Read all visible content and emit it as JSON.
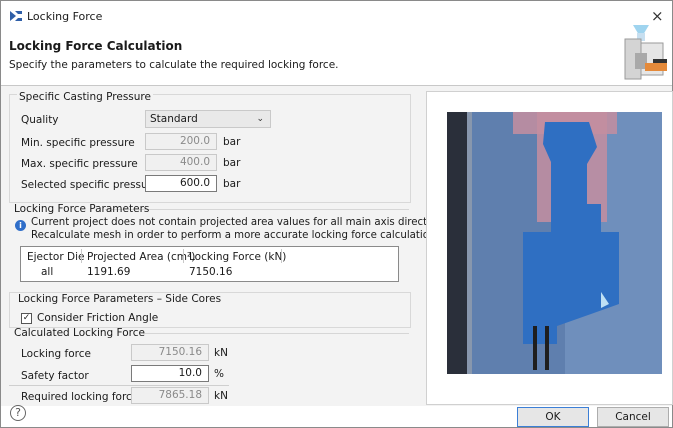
{
  "window": {
    "title": "Locking Force",
    "close_symbol": "×"
  },
  "header": {
    "title": "Locking Force Calculation",
    "subtitle": "Specify the parameters to calculate the required locking force."
  },
  "casting_pressure": {
    "group_title": "Specific Casting Pressure",
    "quality_label": "Quality",
    "quality_value": "Standard",
    "min_label": "Min. specific pressure",
    "min_value": "200.0",
    "max_label": "Max. specific pressure",
    "max_value": "400.0",
    "selected_label": "Selected specific pressure",
    "selected_value": "600.0",
    "unit": "bar"
  },
  "locking_params": {
    "group_title": "Locking Force Parameters",
    "info_line1": "Current project does not contain projected area values for all main axis directions.",
    "info_line2": "Recalculate mesh in order to perform a more accurate locking force calculation.",
    "table": {
      "headers": [
        "Ejector Die",
        "Projected Area (cm²)",
        "Locking Force (kN)"
      ],
      "rows": [
        [
          "all",
          "1191.69",
          "7150.16"
        ]
      ]
    }
  },
  "side_cores": {
    "group_title": "Locking Force Parameters  –  Side Cores",
    "friction_label": "Consider Friction Angle",
    "friction_checked": true
  },
  "calculated": {
    "group_title": "Calculated Locking Force",
    "locking_label": "Locking force",
    "locking_value": "7150.16",
    "locking_unit": "kN",
    "safety_label": "Safety factor",
    "safety_value": "10.0",
    "safety_unit": "%",
    "required_label": "Required locking force",
    "required_value": "7865.18",
    "required_unit": "kN"
  },
  "buttons": {
    "ok": "OK",
    "cancel": "Cancel",
    "help_symbol": "?"
  },
  "icons": {
    "app": "locking-force-app-icon",
    "info": "info-icon",
    "help": "help-icon",
    "dropdown": "chevron-down-icon",
    "header": "die-casting-machine-icon",
    "preview": "casting-part-preview"
  },
  "colors": {
    "preview_background": "#5f7fae",
    "part_blue": "#2f6fc2",
    "part_pink": "#c48ea0",
    "dark_core": "#2a2f3a",
    "accent_blue": "#3c7fd6"
  }
}
